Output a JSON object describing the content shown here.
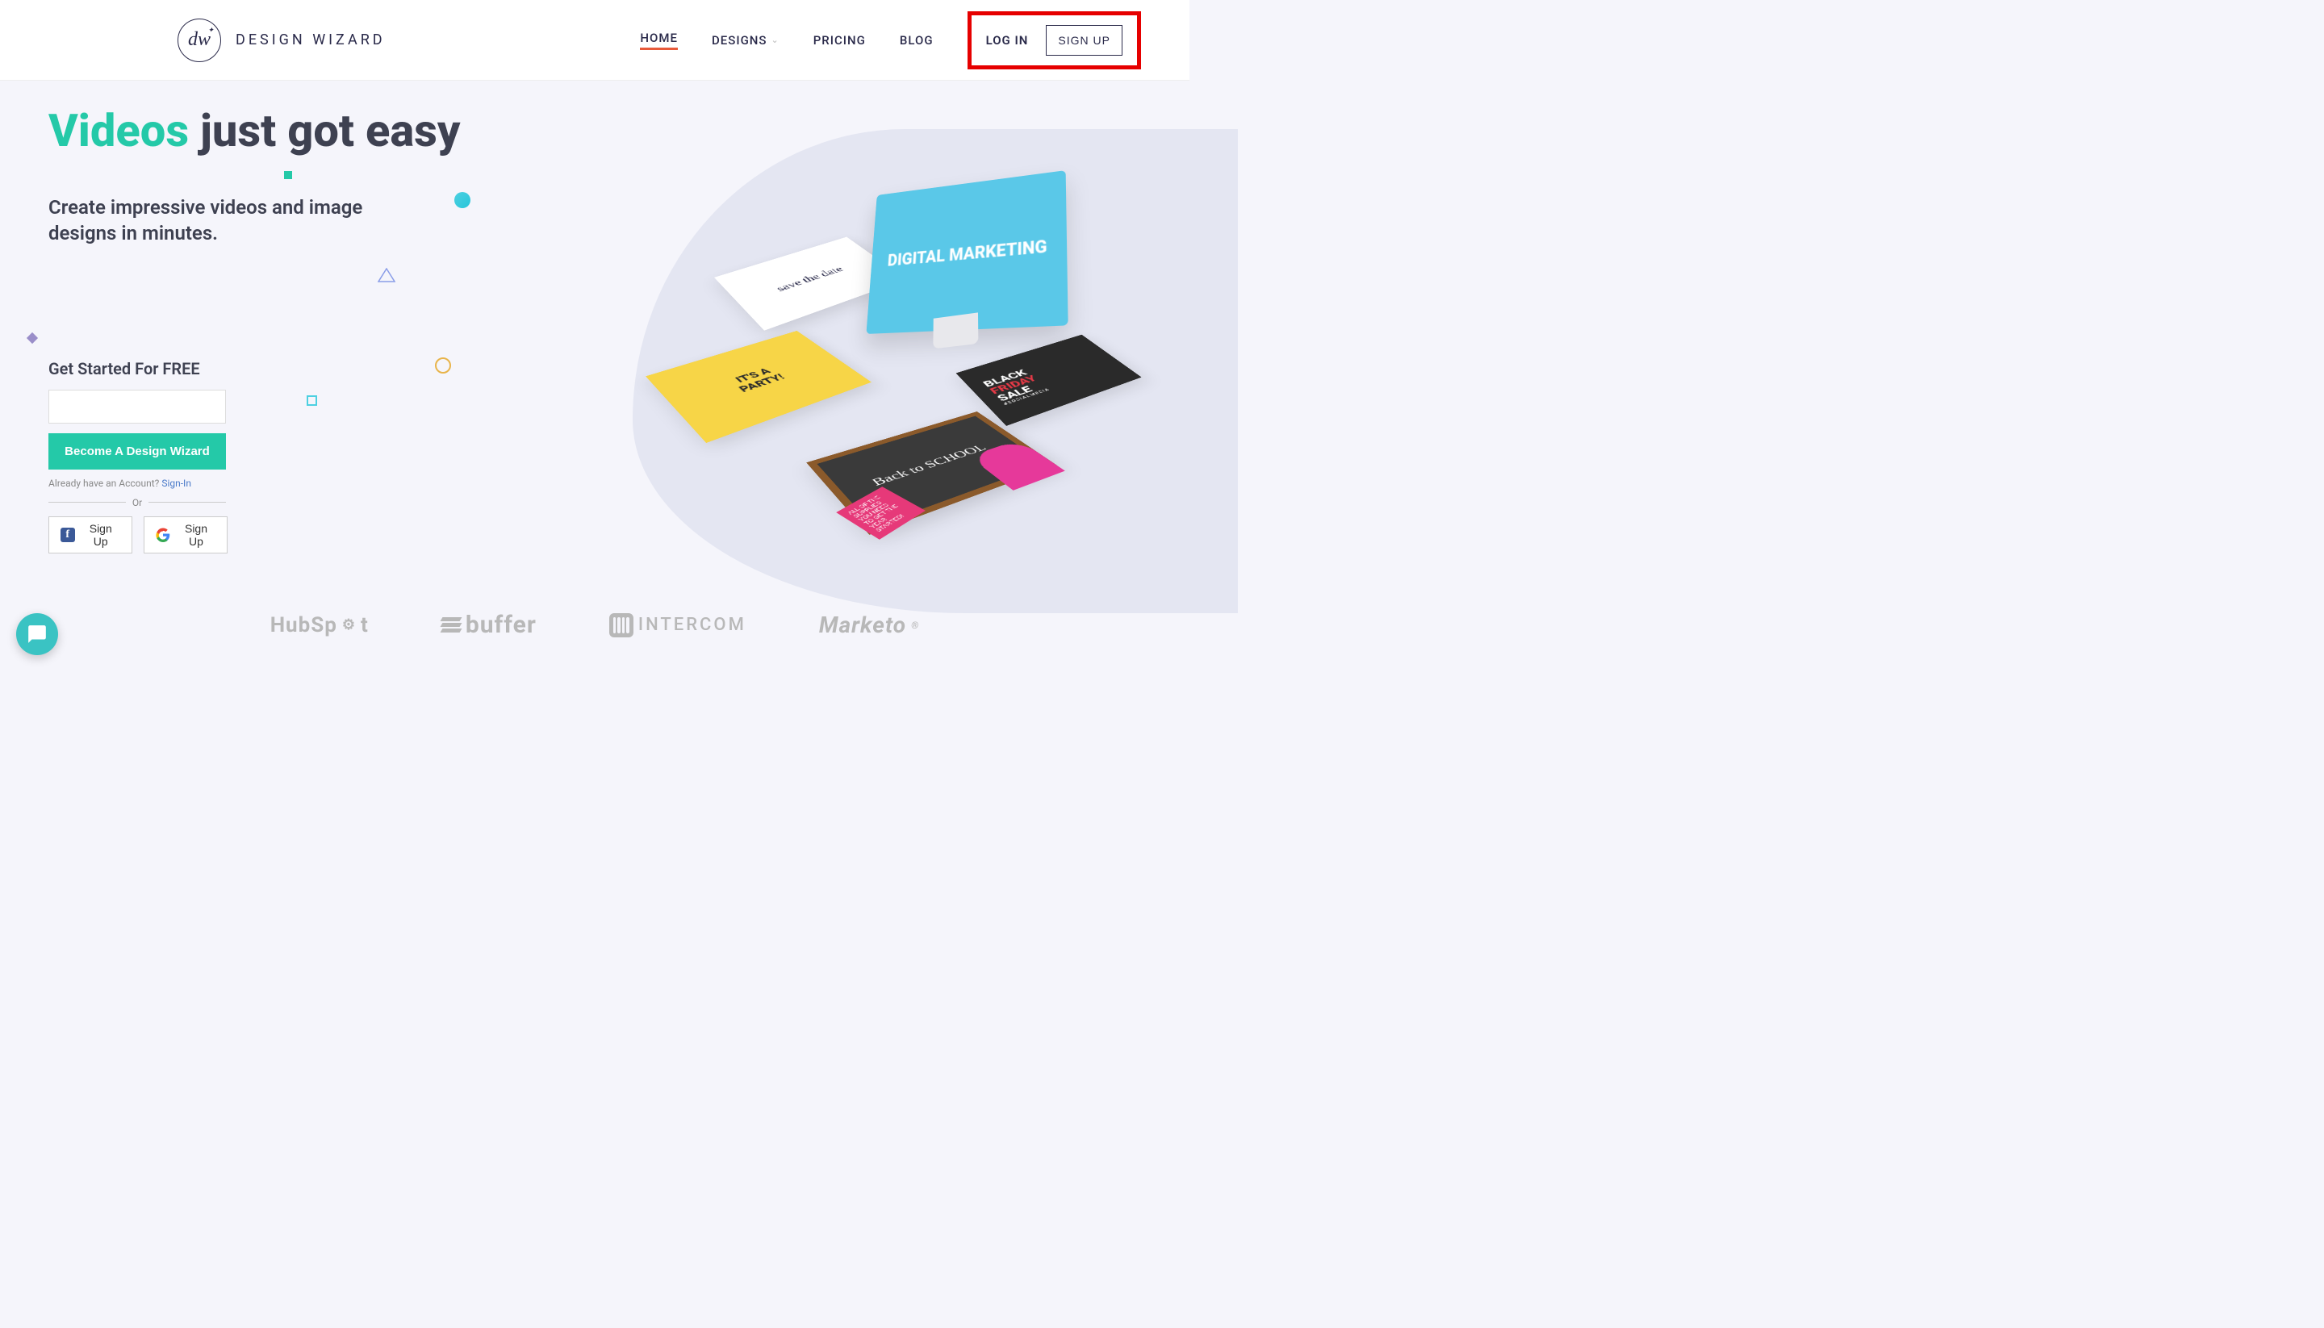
{
  "brand": {
    "logo_initials": "dw",
    "name": "DESIGN WIZARD"
  },
  "nav": {
    "home": "HOME",
    "designs": "DESIGNS",
    "pricing": "PRICING",
    "blog": "BLOG",
    "login": "LOG IN",
    "signup": "SIGN UP"
  },
  "hero": {
    "title_accent": "Videos",
    "title_rest": " just got easy",
    "subtitle": "Create impressive videos and image designs in minutes."
  },
  "form": {
    "heading": "Get Started For FREE",
    "cta": "Become A Design Wizard",
    "already_text": "Already have an Account? ",
    "signin_link": "Sign-In",
    "or": "Or",
    "fb_signup": "Sign Up",
    "google_signup": "Sign Up"
  },
  "mockups": {
    "monitor": "DIGITAL MARKETING",
    "flower": "save the date",
    "party_top": "IT'S A",
    "party_bottom": "PARTY!",
    "bf_line1": "BLACK",
    "bf_line2": "FRIDAY",
    "bf_line3": "SALE",
    "bf_tag": "#SOCIALMEDIA",
    "school": "Back to SCHOOL",
    "school_tag": "ALL OF THE SUPPLIES YOU NEED TO GET THE YEAR STARTED!"
  },
  "partners": {
    "hubspot": "HubSpot",
    "buffer": "buffer",
    "intercom": "INTERCOM",
    "marketo": "Marketo"
  }
}
